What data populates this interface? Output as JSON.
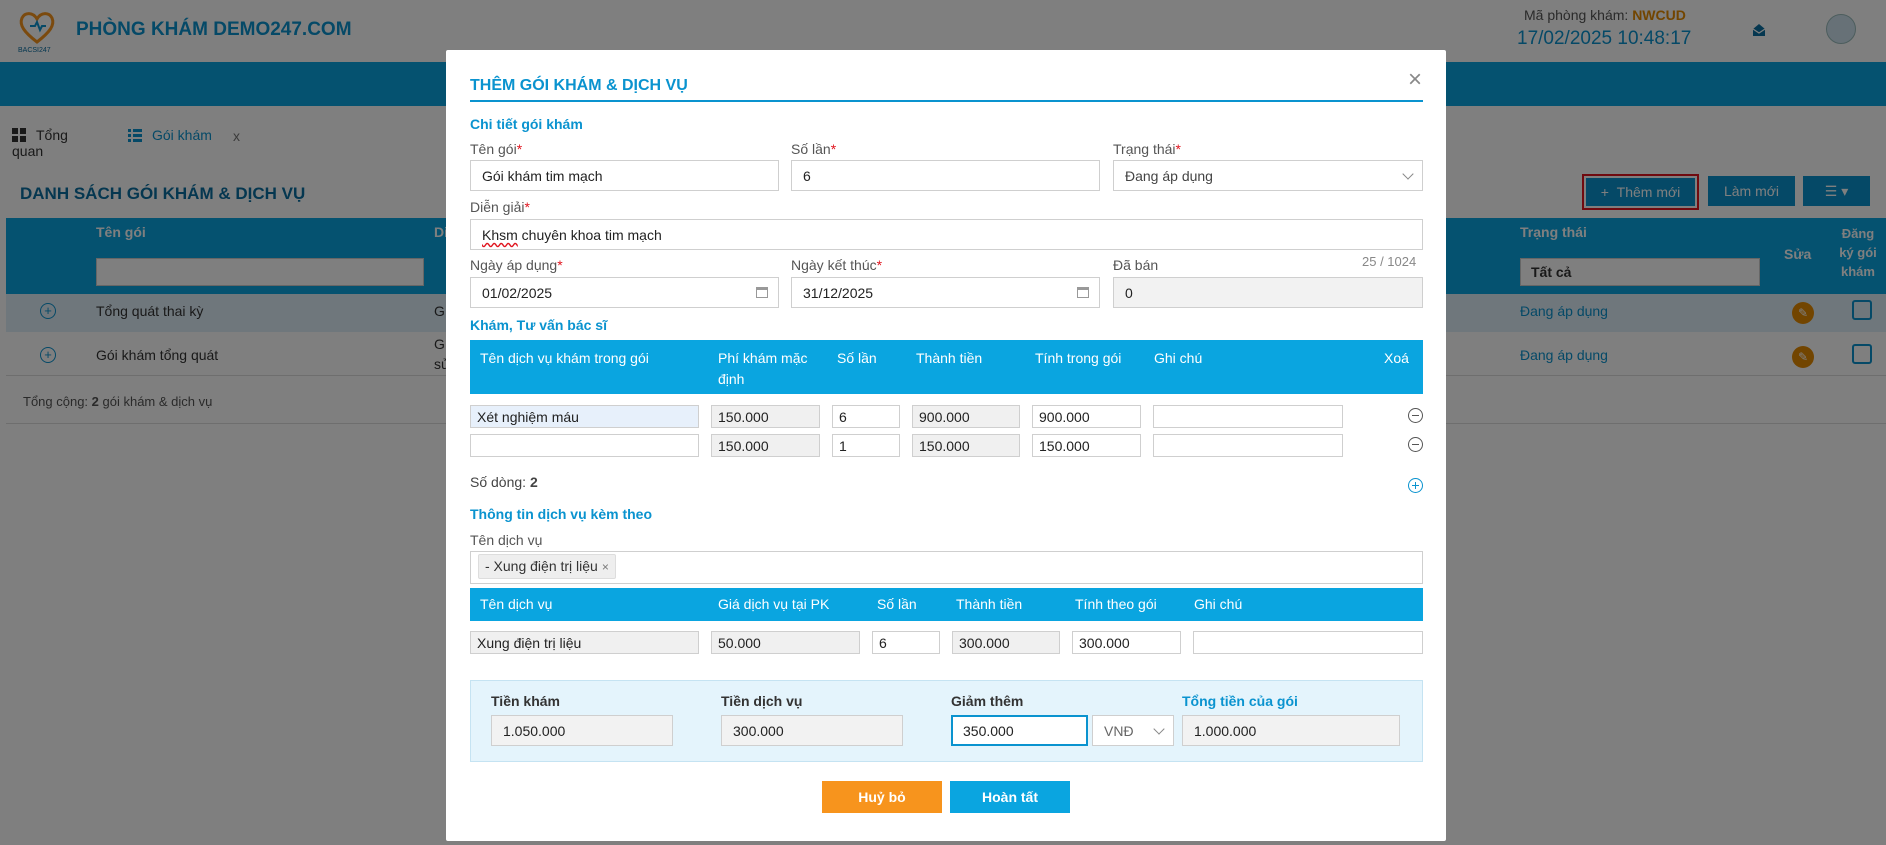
{
  "header": {
    "clinic_name": "PHÒNG KHÁM DEMO247.COM",
    "logo_text": "BACSI247",
    "clinic_code_label": "Mã phòng khám:",
    "clinic_code": "NWCUD",
    "datetime": "17/02/2025 10:48:17",
    "icons": [
      "notification-icon",
      "avatar"
    ]
  },
  "tabs": [
    {
      "label": "Tổng quan",
      "icon": "dashboard-icon"
    },
    {
      "label": "Gói khám",
      "icon": "list-icon",
      "close": "x"
    }
  ],
  "list": {
    "title": "DANH SÁCH GÓI KHÁM & DỊCH VỤ",
    "add_label": "Thêm mới",
    "refresh_label": "Làm mới",
    "columns": {
      "name": "Tên gói",
      "desc": "Di",
      "status": "Trạng thái",
      "edit": "Sửa",
      "register": "Đăng ký gói khám"
    },
    "status_filter": "Tất cả",
    "rows": [
      {
        "name": "Tổng quát thai kỳ",
        "desc": "G",
        "status": "Đang áp dụng"
      },
      {
        "name": "Gói khám tổng quát",
        "desc": "G",
        "desc2": "sử",
        "status": "Đang áp dụng"
      }
    ],
    "footer_prefix": "Tổng cộng: ",
    "footer_count": "2",
    "footer_suffix": " gói khám & dịch vụ"
  },
  "modal": {
    "title": "THÊM GÓI KHÁM & DỊCH VỤ",
    "close": "×",
    "section_detail": "Chi tiết gói khám",
    "name_label": "Tên gói",
    "name_value": "Gói khám tim mạch",
    "times_label": "Số lần",
    "times_value": "6",
    "status_label": "Trạng thái",
    "status_value": "Đang áp dụng",
    "desc_label": "Diễn giải",
    "desc_value_word": "Khsm",
    "desc_value_rest": " chuyên khoa tim mạch",
    "desc_counter": "25 / 1024",
    "start_label": "Ngày áp dụng",
    "start_value": "01/02/2025",
    "end_label": "Ngày kết thúc",
    "end_value": "31/12/2025",
    "sold_label": "Đã bán",
    "sold_value": "0",
    "required_mark": "*",
    "section_exam": "Khám, Tư vấn bác sĩ",
    "exam_columns": [
      "Tên dịch vụ khám trong gói",
      "Phí khám mặc định",
      "Số lần",
      "Thành tiền",
      "Tính trong gói",
      "Ghi chú",
      "Xoá"
    ],
    "exam_rows": [
      {
        "service": "Xét nghiệm máu",
        "fee": "150.000",
        "times": "6",
        "total": "900.000",
        "in_pkg": "900.000",
        "note": ""
      },
      {
        "service": "",
        "fee": "150.000",
        "times": "1",
        "total": "150.000",
        "in_pkg": "150.000",
        "note": ""
      }
    ],
    "row_count_label": "Số dòng: ",
    "row_count": "2",
    "section_extra": "Thông tin dịch vụ kèm theo",
    "extra_label": "Tên dịch vụ",
    "extra_tag": "- Xung điện trị liệu",
    "extra_tag_close": "×",
    "extra_columns": [
      "Tên dịch vụ",
      "Giá dịch vụ tại PK",
      "Số lần",
      "Thành tiền",
      "Tính theo gói",
      "Ghi chú"
    ],
    "extra_rows": [
      {
        "service": "Xung điện trị liệu",
        "price": "50.000",
        "times": "6",
        "total": "300.000",
        "in_pkg": "300.000",
        "note": ""
      }
    ],
    "summary": {
      "exam_label": "Tiền khám",
      "exam_value": "1.050.000",
      "service_label": "Tiền dịch vụ",
      "service_value": "300.000",
      "discount_label": "Giảm thêm",
      "discount_value": "350.000",
      "discount_unit": "VNĐ",
      "total_label": "Tổng tiền của gói",
      "total_value": "1.000.000"
    },
    "cancel_label": "Huỷ bỏ",
    "done_label": "Hoàn tất"
  },
  "colors": {
    "primary": "#0aa5e0",
    "accent": "#f7941d",
    "required": "#e0141e",
    "highlight": "#e58a00"
  }
}
